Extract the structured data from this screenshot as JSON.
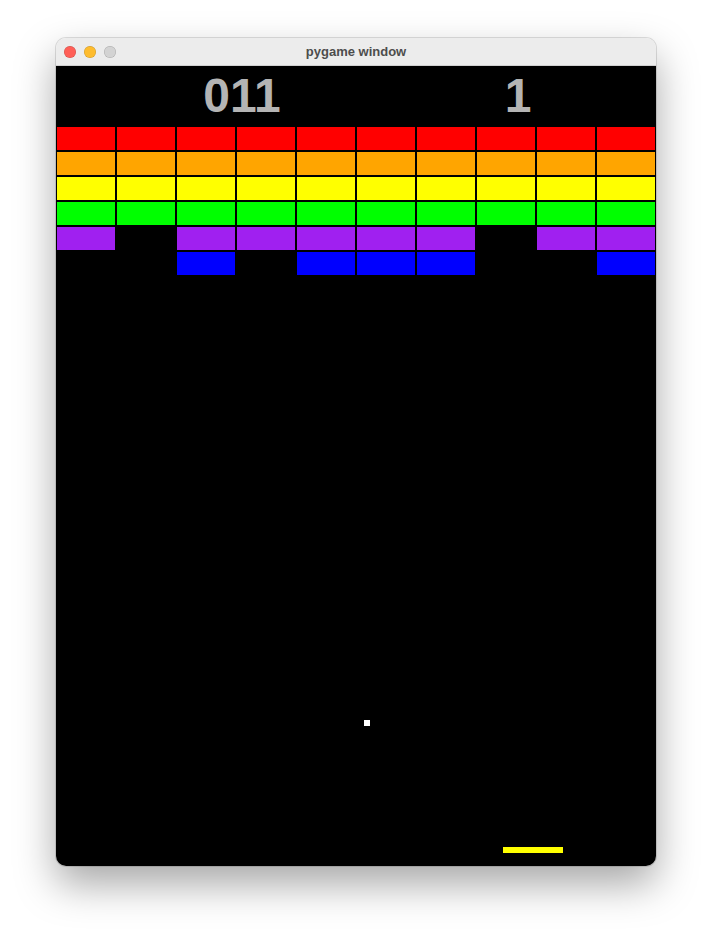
{
  "window": {
    "title": "pygame window",
    "controls": [
      {
        "kind": "close",
        "disabled": false
      },
      {
        "kind": "minimize",
        "disabled": false
      },
      {
        "kind": "zoom",
        "disabled": true
      }
    ]
  },
  "scores": [
    "011",
    "1"
  ],
  "bricks": [
    {
      "color": "#ff0000",
      "cells": [
        {
          "present": true
        },
        {
          "present": true
        },
        {
          "present": true
        },
        {
          "present": true
        },
        {
          "present": true
        },
        {
          "present": true
        },
        {
          "present": true
        },
        {
          "present": true
        },
        {
          "present": true
        },
        {
          "present": true
        }
      ]
    },
    {
      "color": "#ffa500",
      "cells": [
        {
          "present": true
        },
        {
          "present": true
        },
        {
          "present": true
        },
        {
          "present": true
        },
        {
          "present": true
        },
        {
          "present": true
        },
        {
          "present": true
        },
        {
          "present": true
        },
        {
          "present": true
        },
        {
          "present": true
        }
      ]
    },
    {
      "color": "#ffff00",
      "cells": [
        {
          "present": true
        },
        {
          "present": true
        },
        {
          "present": true
        },
        {
          "present": true
        },
        {
          "present": true
        },
        {
          "present": true
        },
        {
          "present": true
        },
        {
          "present": true
        },
        {
          "present": true
        },
        {
          "present": true
        }
      ]
    },
    {
      "color": "#00ff00",
      "cells": [
        {
          "present": true
        },
        {
          "present": true
        },
        {
          "present": true
        },
        {
          "present": true
        },
        {
          "present": true
        },
        {
          "present": true
        },
        {
          "present": true
        },
        {
          "present": true
        },
        {
          "present": true
        },
        {
          "present": true
        }
      ]
    },
    {
      "color": "#a020f0",
      "cells": [
        {
          "present": true
        },
        {
          "present": false
        },
        {
          "present": true
        },
        {
          "present": true
        },
        {
          "present": true
        },
        {
          "present": true
        },
        {
          "present": true
        },
        {
          "present": false
        },
        {
          "present": true
        },
        {
          "present": true
        }
      ]
    },
    {
      "color": "#0000ff",
      "cells": [
        {
          "present": false
        },
        {
          "present": false
        },
        {
          "present": true
        },
        {
          "present": false
        },
        {
          "present": true
        },
        {
          "present": true
        },
        {
          "present": true
        },
        {
          "present": false
        },
        {
          "present": false
        },
        {
          "present": true
        }
      ]
    }
  ],
  "ball": {
    "color": "#ffffff"
  },
  "paddle": {
    "color": "#ffff00"
  }
}
